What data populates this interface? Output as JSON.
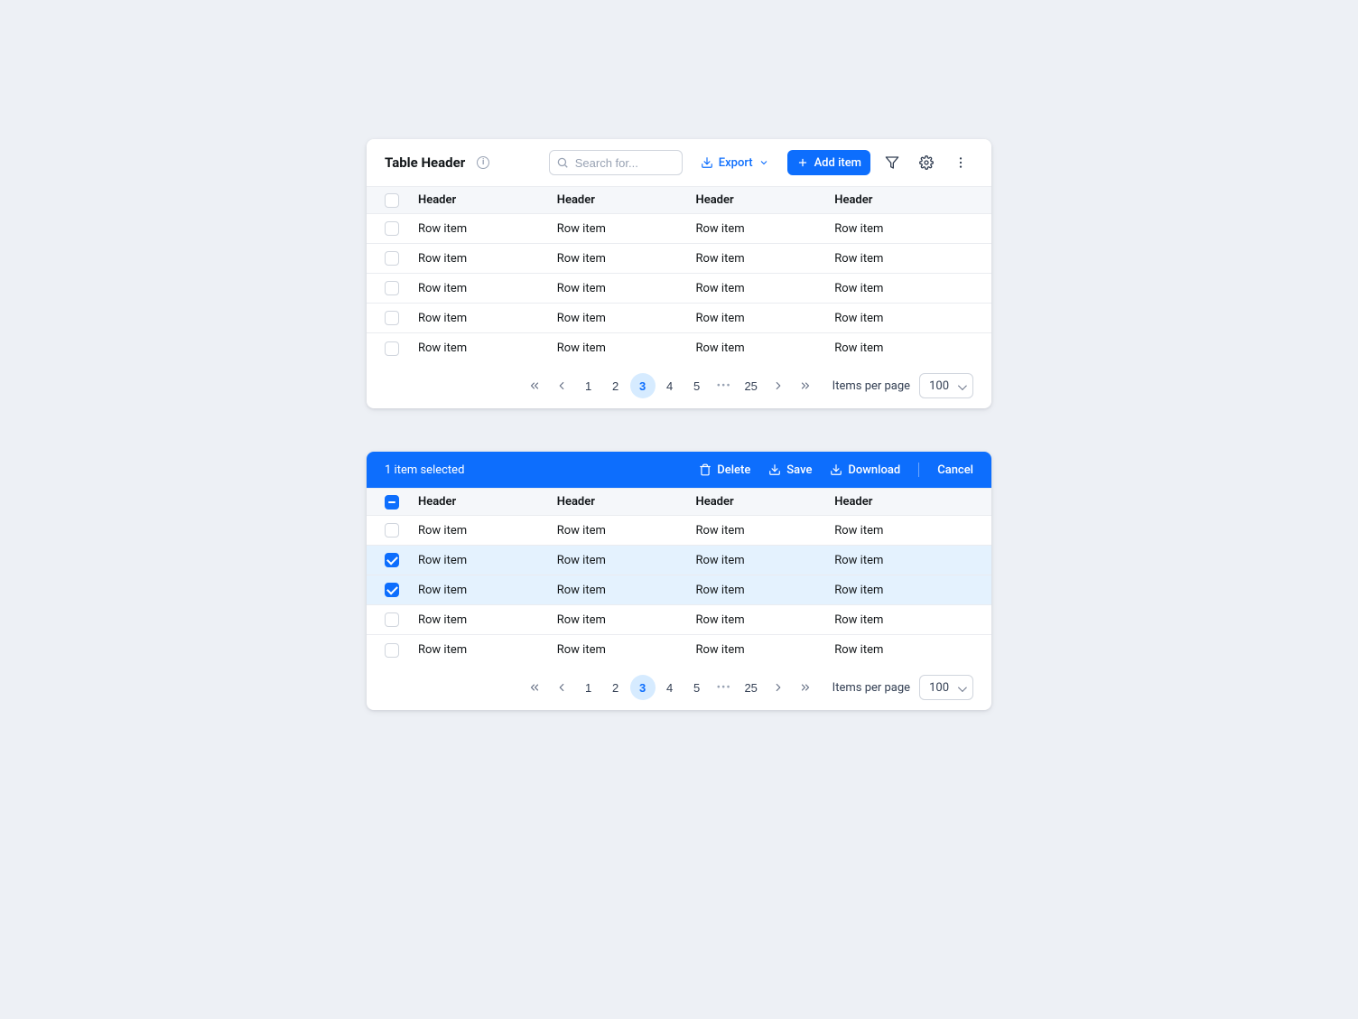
{
  "table1": {
    "title": "Table Header",
    "search_placeholder": "Search for...",
    "export_label": "Export",
    "add_label": "Add item",
    "cols": [
      "Header",
      "Header",
      "Header",
      "Header"
    ],
    "rows": [
      [
        "Row item",
        "Row item",
        "Row item",
        "Row item"
      ],
      [
        "Row item",
        "Row item",
        "Row item",
        "Row item"
      ],
      [
        "Row item",
        "Row item",
        "Row item",
        "Row item"
      ],
      [
        "Row item",
        "Row item",
        "Row item",
        "Row item"
      ],
      [
        "Row item",
        "Row item",
        "Row item",
        "Row item"
      ]
    ]
  },
  "table2": {
    "selection_text": "1 item selected",
    "delete_label": "Delete",
    "save_label": "Save",
    "download_label": "Download",
    "cancel_label": "Cancel",
    "cols": [
      "Header",
      "Header",
      "Header",
      "Header"
    ],
    "rows": [
      {
        "sel": false,
        "cells": [
          "Row item",
          "Row item",
          "Row item",
          "Row item"
        ]
      },
      {
        "sel": true,
        "cells": [
          "Row item",
          "Row item",
          "Row item",
          "Row item"
        ]
      },
      {
        "sel": true,
        "cells": [
          "Row item",
          "Row item",
          "Row item",
          "Row item"
        ]
      },
      {
        "sel": false,
        "cells": [
          "Row item",
          "Row item",
          "Row item",
          "Row item"
        ]
      },
      {
        "sel": false,
        "cells": [
          "Row item",
          "Row item",
          "Row item",
          "Row item"
        ]
      }
    ]
  },
  "pagination": {
    "pages": [
      "1",
      "2",
      "3",
      "4",
      "5"
    ],
    "current": "3",
    "last": "25",
    "label": "Items per page",
    "size": "100"
  }
}
